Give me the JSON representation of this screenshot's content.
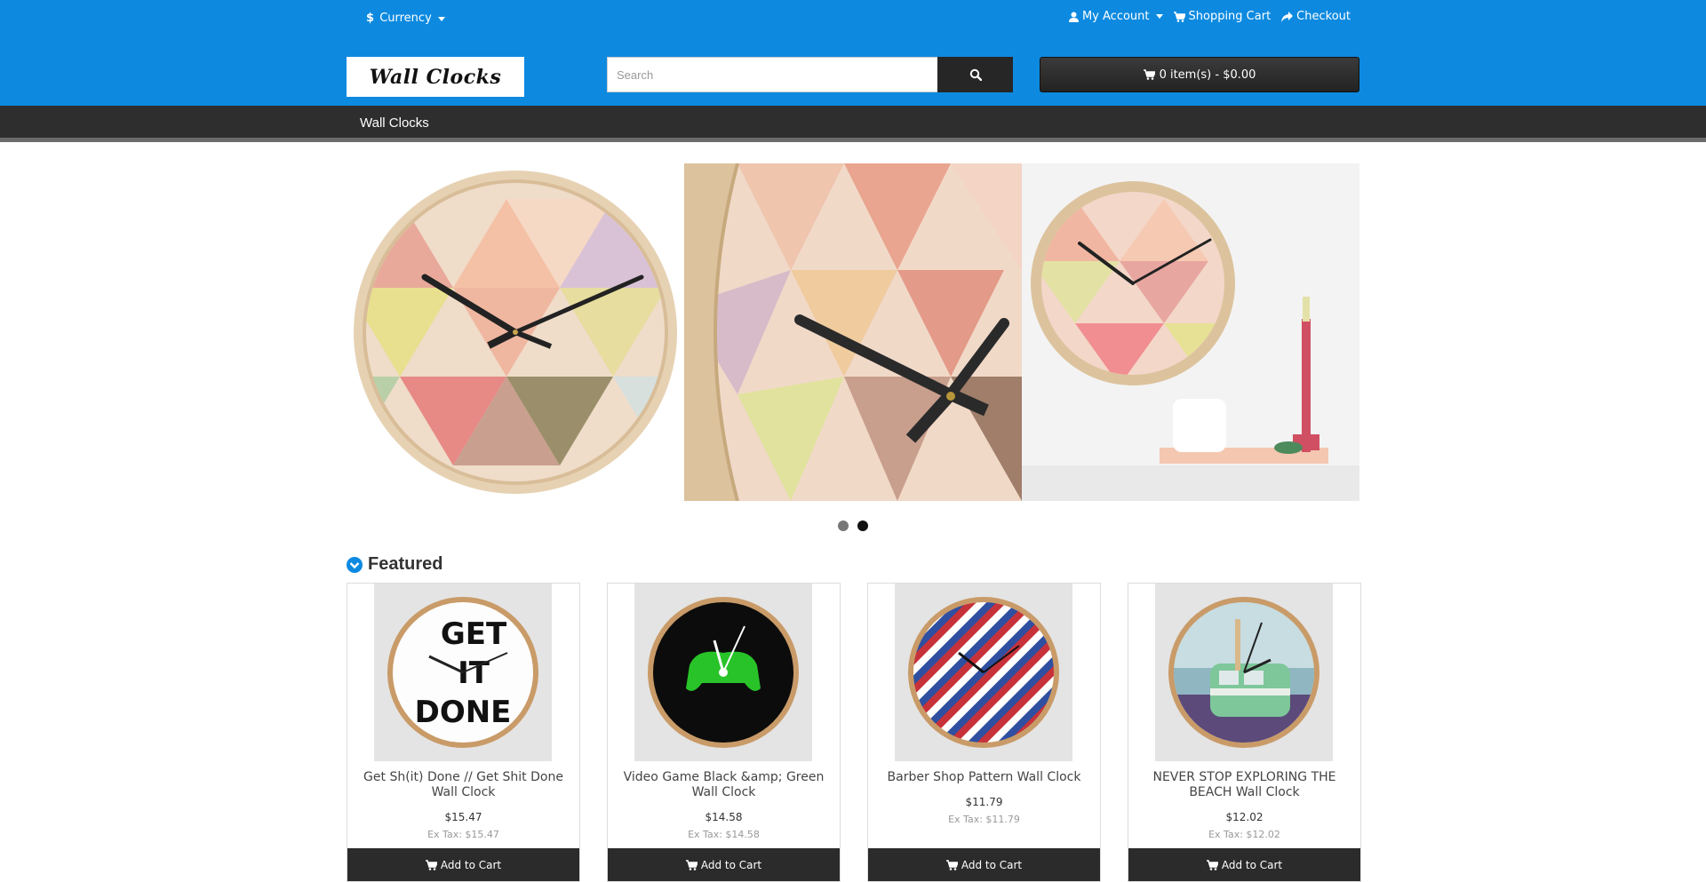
{
  "header": {
    "currency_symbol": "$",
    "currency_label": "Currency",
    "links": {
      "account": "My Account",
      "cart": "Shopping Cart",
      "checkout": "Checkout"
    },
    "logo_text": "Wall Clocks",
    "search_placeholder": "Search",
    "cart_summary": "0 item(s) - $0.00",
    "accent_color": "#0d8ae0"
  },
  "nav": {
    "items": [
      "Wall Clocks"
    ]
  },
  "carousel": {
    "slide_count": 2,
    "active_index": 1
  },
  "featured": {
    "title": "Featured",
    "products": [
      {
        "name": "Get Sh(it) Done // Get Shit Done Wall Clock",
        "price": "$15.47",
        "ex_tax": "Ex Tax: $15.47",
        "button": "Add to Cart"
      },
      {
        "name": "Video Game Black &amp; Green Wall Clock",
        "price": "$14.58",
        "ex_tax": "Ex Tax: $14.58",
        "button": "Add to Cart"
      },
      {
        "name": "Barber Shop Pattern Wall Clock",
        "price": "$11.79",
        "ex_tax": "Ex Tax: $11.79",
        "button": "Add to Cart"
      },
      {
        "name": "NEVER STOP EXPLORING THE BEACH Wall Clock",
        "price": "$12.02",
        "ex_tax": "Ex Tax: $12.02",
        "button": "Add to Cart"
      }
    ]
  }
}
